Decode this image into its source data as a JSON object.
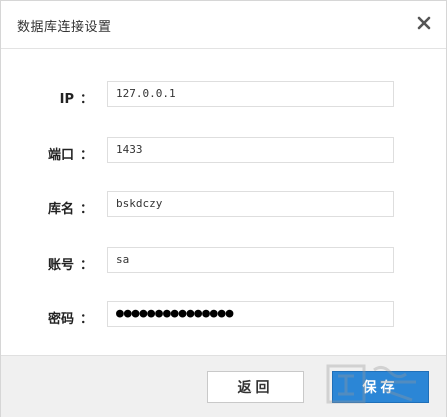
{
  "dialog": {
    "title": "数据库连接设置",
    "close_icon": "close-icon"
  },
  "form": {
    "fields": [
      {
        "label": "IP",
        "value": "127.0.0.1"
      },
      {
        "label": "端口",
        "value": "1433"
      },
      {
        "label": "库名",
        "value": "bskdczy"
      },
      {
        "label": "账号",
        "value": "sa"
      },
      {
        "label": "密码",
        "value": "●●●●●●●●●●●●●●●",
        "masked": true
      }
    ],
    "colon": "："
  },
  "footer": {
    "back_label": "返回",
    "save_label": "保存"
  },
  "colors": {
    "primary": "#2b86d6",
    "footer_bg": "#f0f0f0"
  }
}
